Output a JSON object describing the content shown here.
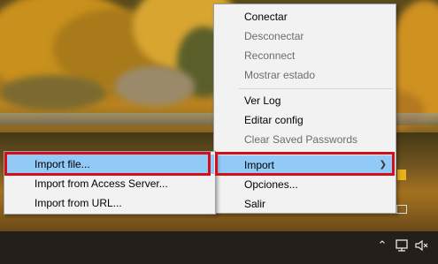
{
  "main_menu": {
    "connect": "Conectar",
    "disconnect": "Desconectar",
    "reconnect": "Reconnect",
    "show_status": "Mostrar estado",
    "view_log": "Ver Log",
    "edit_config": "Editar config",
    "clear_passwords": "Clear Saved Passwords",
    "import": "Import",
    "options": "Opciones...",
    "exit": "Salir"
  },
  "import_submenu": {
    "import_file": "Import file...",
    "import_access_server": "Import from Access Server...",
    "import_url": "Import from URL..."
  },
  "colors": {
    "highlight": "#91c9f7",
    "annotation_red": "#d40f1a",
    "disabled_text": "#6d6d6d"
  },
  "tray_icons": [
    "chevron-up-icon",
    "network-icon",
    "volume-muted-icon"
  ]
}
